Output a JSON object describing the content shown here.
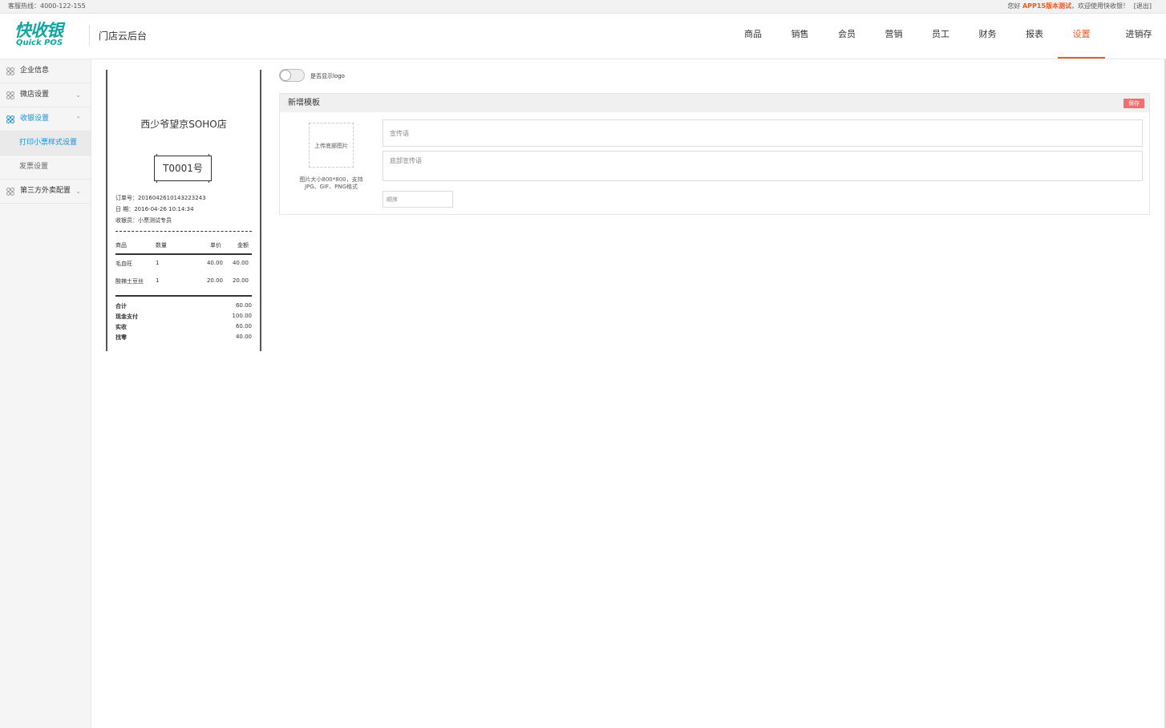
{
  "topbar": {
    "hotline_label": "客服热线：",
    "hotline_number": "4000-122-155",
    "greeting_prefix": "您好 ",
    "user_name": "APP15版本测试",
    "greeting_suffix": "，欢迎使用快收银！",
    "logout": "[退出]"
  },
  "header": {
    "logo_cn": "快收银",
    "logo_en": "Quick POS",
    "title": "门店云后台",
    "nav": [
      "商品",
      "销售",
      "会员",
      "营销",
      "员工",
      "财务",
      "报表",
      "设置",
      "进销存"
    ],
    "active_nav": "设置"
  },
  "sidebar": {
    "items": [
      {
        "label": "企业信息"
      },
      {
        "label": "微店设置",
        "chevron": "chevron-down"
      },
      {
        "label": "收银设置",
        "chevron": "chevron-up",
        "active": true
      },
      {
        "label": "打印小票样式设置",
        "sub": true,
        "active": true
      },
      {
        "label": "发票设置",
        "sub": true
      },
      {
        "label": "第三方外卖配置",
        "chevron": "chevron-down"
      }
    ]
  },
  "receipt": {
    "store_name": "西少爷望京SOHO店",
    "table_no": "T0001号",
    "order_no": "订单号：2016042610143223243",
    "date": "日 期：2016-04-26 10:14:34",
    "cashier": "收银员：小票测试专员",
    "headers": [
      "商品",
      "数量",
      "单价",
      "金额"
    ],
    "rows": [
      [
        "毛血旺",
        "1",
        "40.00",
        "40.00"
      ],
      [
        "酸辣土豆丝",
        "1",
        "20.00",
        "20.00"
      ]
    ],
    "totals": [
      [
        "合计",
        "60.00"
      ],
      [
        "现金支付",
        "100.00"
      ],
      [
        "实收",
        "60.00"
      ],
      [
        "找零",
        "40.00"
      ]
    ]
  },
  "logo_toggle": {
    "label": "是否显示logo",
    "on": false
  },
  "template_panel": {
    "title": "新增模板",
    "save_label": "保存",
    "upload_label": "上传底部图片",
    "upload_hint_line1": "图片大小800*800，支持",
    "upload_hint_line2": "JPG、GIF、PNG格式",
    "slogan_placeholder": "宣传语",
    "bottom_slogan_placeholder": "底部宣传语",
    "order_placeholder": "顺序"
  },
  "colors": {
    "accent": "#e85a1e",
    "sidebar_active": "#1a8fd6",
    "logo": "#12a6a0",
    "save_button": "#f36f6f"
  }
}
